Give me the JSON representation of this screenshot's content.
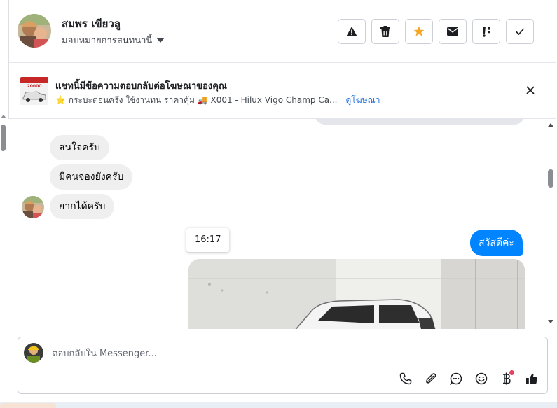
{
  "header": {
    "contact_name": "สมพร เขียวลู",
    "assign_label": "มอบหมายการสนทนานี้",
    "actions": [
      {
        "name": "report-spam-button",
        "icon": "warning-icon"
      },
      {
        "name": "delete-button",
        "icon": "trash-icon"
      },
      {
        "name": "star-button",
        "icon": "star-icon",
        "color": "#f5a623"
      },
      {
        "name": "mark-unread-button",
        "icon": "envelope-icon"
      },
      {
        "name": "follow-up-button",
        "icon": "exclamation-icon"
      },
      {
        "name": "mark-done-button",
        "icon": "check-icon"
      }
    ]
  },
  "ad_banner": {
    "title": "แชทนี้มีข้อความตอบกลับต่อโฆษณาของคุณ",
    "subtitle": "⭐ กระบะตอนครึ่ง ใช้งานทน ราคาคุ้ม 🚚 X001 - Hilux Vigo Champ Ca...",
    "link": "ดูโฆษณา",
    "thumb_text": "20000"
  },
  "chat": {
    "incoming": [
      "สนใจครับ",
      "มีคนจองยังครับ",
      "ยากได้ครับ"
    ],
    "timestamp": "16:17",
    "outgoing": [
      "สวัสดีค่ะ"
    ]
  },
  "composer": {
    "placeholder": "ตอบกลับใน Messenger...",
    "tools": [
      "phone-icon",
      "paperclip-icon",
      "saved-reply-icon",
      "emoji-icon",
      "baht-icon",
      "thumbs-up-icon"
    ]
  },
  "colors": {
    "accent": "#0084ff",
    "star": "#f5a623",
    "incoming_bubble": "#efefef",
    "link": "#216fdb",
    "notification_dot": "#e4405f"
  }
}
